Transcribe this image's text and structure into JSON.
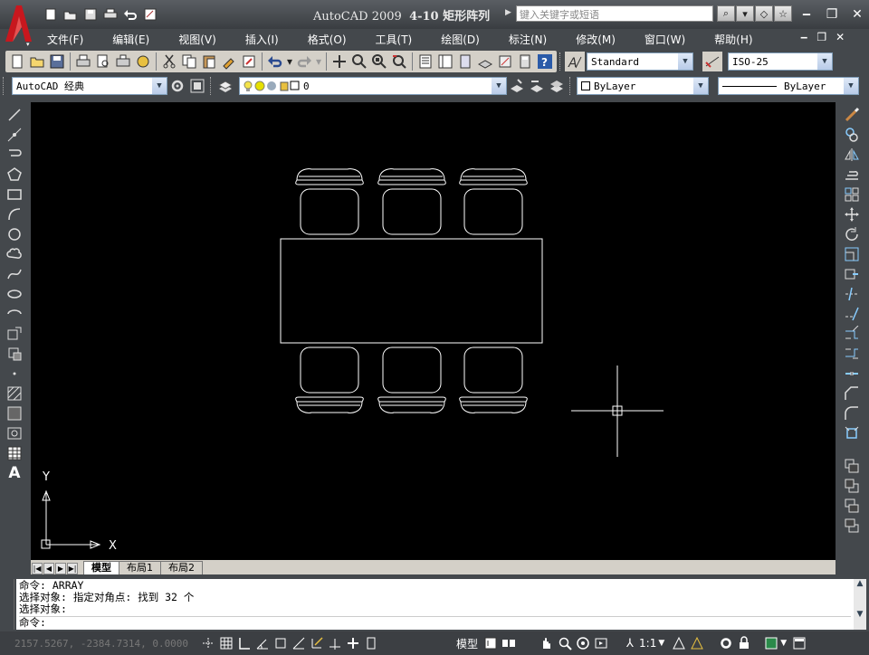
{
  "app": {
    "name": "AutoCAD 2009",
    "doc_title": "4-10 矩形阵列",
    "search_placeholder": "键入关键字或短语"
  },
  "menu": [
    "文件(F)",
    "编辑(E)",
    "视图(V)",
    "插入(I)",
    "格式(O)",
    "工具(T)",
    "绘图(D)",
    "标注(N)",
    "修改(M)",
    "窗口(W)",
    "帮助(H)"
  ],
  "toolbar": {
    "text_style": "Standard",
    "dim_style": "ISO-25",
    "workspace": "AutoCAD 经典",
    "layer": "0",
    "color": "ByLayer",
    "linetype": "ByLayer"
  },
  "tabs": [
    "模型",
    "布局1",
    "布局2"
  ],
  "axes": {
    "x": "X",
    "y": "Y"
  },
  "command": {
    "lines": [
      "命令:  ARRAY",
      "选择对象: 指定对角点: 找到 32 个",
      "选择对象:"
    ],
    "prompt": "命令:"
  },
  "status": {
    "coords": "2157.5267, -2384.7314, 0.0000",
    "model": "模型",
    "scale": "1:1"
  },
  "colors": {
    "canvas": "#000000",
    "chrome": "#44484c",
    "logo": "#c8171e"
  }
}
